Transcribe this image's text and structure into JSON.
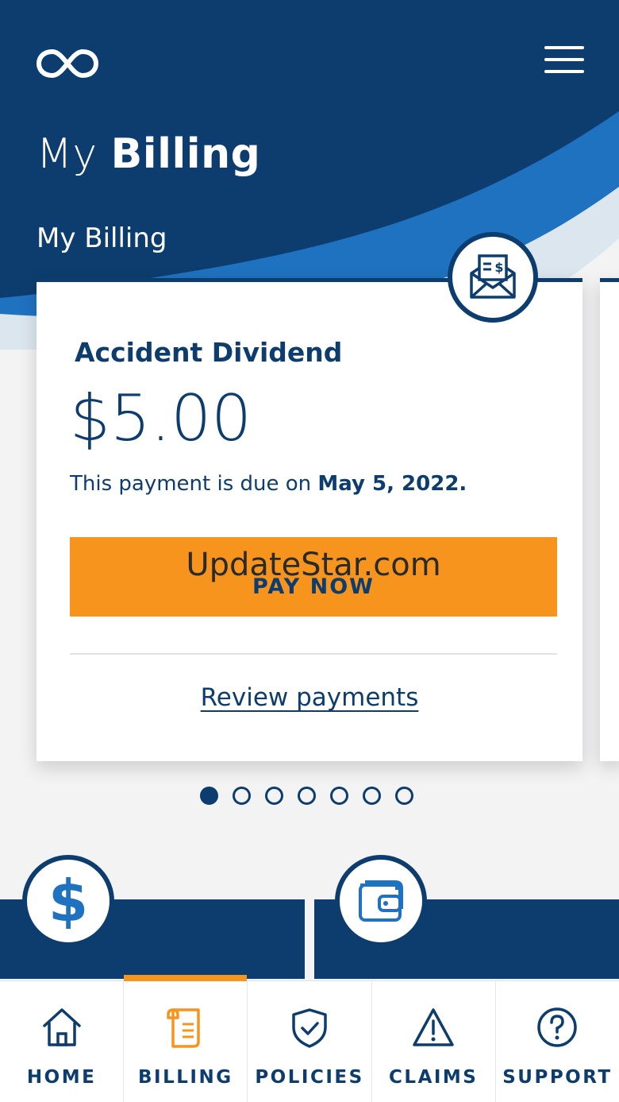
{
  "header": {
    "logo_icon": "infinity-logo-icon",
    "menu_icon": "hamburger-menu-icon",
    "title_light": "My ",
    "title_bold": "Billing",
    "section_label": "My Billing"
  },
  "billing_card": {
    "badge_icon": "envelope-bill-icon",
    "policy_name": "Accident Dividend",
    "amount": "$5.00",
    "due_prefix": "This payment is due on ",
    "due_date": "May 5, 2022.",
    "watermark": "UpdateStar.com",
    "pay_button_label": "PAY NOW",
    "review_link": "Review payments"
  },
  "carousel": {
    "total": 7,
    "active_index": 0
  },
  "quick_tiles": [
    {
      "icon": "dollar-icon"
    },
    {
      "icon": "wallet-icon"
    }
  ],
  "bottom_nav": {
    "items": [
      {
        "label": "HOME",
        "icon": "home-icon"
      },
      {
        "label": "BILLING",
        "icon": "billing-document-icon",
        "active": true
      },
      {
        "label": "POLICIES",
        "icon": "shield-check-icon"
      },
      {
        "label": "CLAIMS",
        "icon": "warning-triangle-icon"
      },
      {
        "label": "SUPPORT",
        "icon": "question-circle-icon"
      }
    ]
  },
  "colors": {
    "navy": "#0d3d6e",
    "accent_blue": "#1f72c0",
    "orange": "#f7941d",
    "background": "#f3f3f4"
  }
}
